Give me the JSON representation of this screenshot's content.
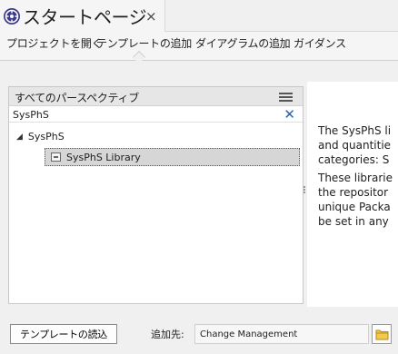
{
  "tab": {
    "title": "スタートページ",
    "close_glyph": "×",
    "icon": "start-page-icon"
  },
  "subtabs": [
    {
      "label": "プロジェクトを開く"
    },
    {
      "label": "テンプレートの追加",
      "active": true
    },
    {
      "label": "ダイアグラムの追加"
    },
    {
      "label": "ガイダンス"
    }
  ],
  "panel": {
    "title": "すべてのパースペクティブ",
    "filter_value": "SysPhS",
    "tree": {
      "root_label": "SysPhS",
      "expanded": true,
      "items": [
        {
          "label": "SysPhS Library",
          "selected": true
        }
      ]
    }
  },
  "description": {
    "para1_lines": [
      "The SysPhS li",
      "and quantitie",
      "categories: S"
    ],
    "para2_lines": [
      "These librarie",
      "the repositor",
      "unique Packa",
      "be set in any"
    ]
  },
  "bottom": {
    "load_button": "テンプレートの読込",
    "add_to_label": "追加先:",
    "target_value": "Change Management"
  }
}
